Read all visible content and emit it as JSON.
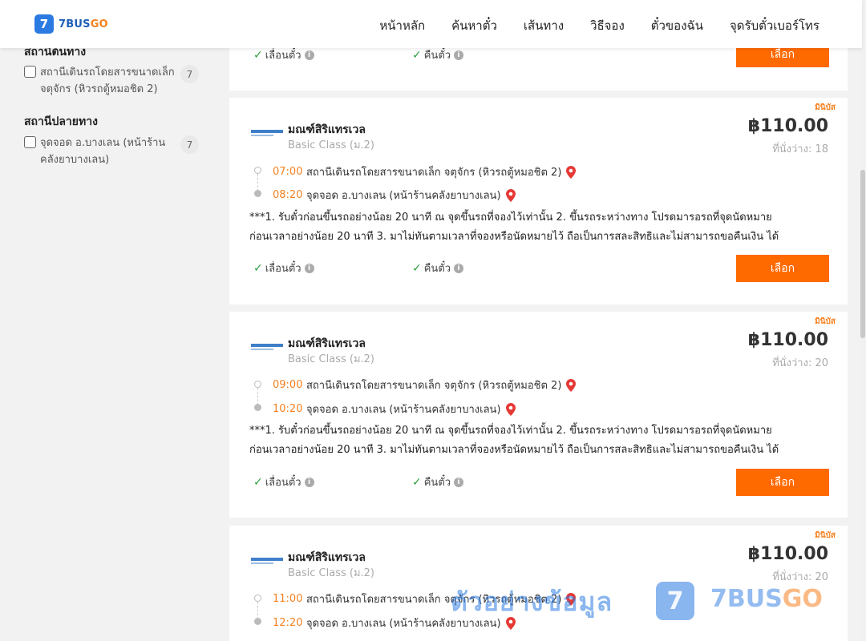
{
  "header": {
    "logo_mark": "7",
    "logo_brand": "7BUS",
    "logo_brand_accent": "GO",
    "nav": [
      "หน้าหลัก",
      "ค้นหาตั๋ว",
      "เส้นทาง",
      "วิธีจอง",
      "ตั๋วของฉัน",
      "จุดรับตั๋วเบอร์โทร"
    ]
  },
  "sidebar": {
    "origin_title": "สถานีต้นทาง",
    "origin_option": "สถานีเดินรถโดยสารขนาดเล็ก จตุจักร (หิวรถตู้หมอชิต 2)",
    "origin_count": "7",
    "dest_title": "สถานีปลายทาง",
    "dest_option": "จุดจอด อ.บางเลน (หน้าร้านคลังยาบางเลน)",
    "dest_count": "7"
  },
  "features": {
    "change": "เลื่อนตั๋ว",
    "refund": "คืนตั๋ว"
  },
  "select_label": "เลือก",
  "top_partial": {
    "change": "เลื่อนตั๋ว",
    "refund": "คืนตั๋ว",
    "button": "เลือก"
  },
  "trips": [
    {
      "type": "มินิบัส",
      "operator": "มณฑ์สิริแทรเวล",
      "class": "Basic Class (ม.2)",
      "price": "฿110.00",
      "seats": "ที่นั่งว่าง: 18",
      "depart_time": "07:00",
      "depart_stop": "สถานีเดินรถโดยสารขนาดเล็ก จตุจักร (หิวรถตู้หมอชิต 2)",
      "arrive_time": "08:20",
      "arrive_stop": "จุดจอด อ.บางเลน (หน้าร้านคลังยาบางเลน)",
      "note_line1": "***1. รับตั๋วก่อนขึ้นรถอย่างน้อย 20 นาที ณ จุดขึ้นรถที่จองไว้เท่านั้น 2. ขึ้นรถระหว่างทาง โปรดมารอรถที่จุดนัดหมาย",
      "note_line2": "ก่อนเวลาอย่างน้อย 20 นาที 3. มาไม่ทันตามเวลาที่จองหรือนัดหมายไว้ ถือเป็นการสละสิทธิและไม่สามารถขอคืนเงิน ได้"
    },
    {
      "type": "มินิบัส",
      "operator": "มณฑ์สิริแทรเวล",
      "class": "Basic Class (ม.2)",
      "price": "฿110.00",
      "seats": "ที่นั่งว่าง: 20",
      "depart_time": "09:00",
      "depart_stop": "สถานีเดินรถโดยสารขนาดเล็ก จตุจักร (หิวรถตู้หมอชิต 2)",
      "arrive_time": "10:20",
      "arrive_stop": "จุดจอด อ.บางเลน (หน้าร้านคลังยาบางเลน)",
      "note_line1": "***1. รับตั๋วก่อนขึ้นรถอย่างน้อย 20 นาที ณ จุดขึ้นรถที่จองไว้เท่านั้น 2. ขึ้นรถระหว่างทาง โปรดมารอรถที่จุดนัดหมาย",
      "note_line2": "ก่อนเวลาอย่างน้อย 20 นาที 3. มาไม่ทันตามเวลาที่จองหรือนัดหมายไว้ ถือเป็นการสละสิทธิและไม่สามารถขอคืนเงิน ได้"
    },
    {
      "type": "มินิบัส",
      "operator": "มณฑ์สิริแทรเวล",
      "class": "Basic Class (ม.2)",
      "price": "฿110.00",
      "seats": "ที่นั่งว่าง: 20",
      "depart_time": "11:00",
      "depart_stop": "สถานีเดินรถโดยสารขนาดเล็ก จตุจักร (หิวรถตู้หมอชิต 2)",
      "arrive_time": "12:20",
      "arrive_stop": "จุดจอด อ.บางเลน (หน้าร้านคลังยาบางเลน)"
    }
  ],
  "watermark": {
    "text": "ตัวอย่างข้อมูล",
    "logo_mark": "7",
    "brand": "7BUS",
    "brand_accent": "GO"
  },
  "colors": {
    "accent": "#ff6a00",
    "brand_blue": "#2a7ae2",
    "time_orange": "#f58220",
    "check_green": "#2e9e3e",
    "pin_red": "#e53935"
  },
  "icons": [
    "checkbox-icon",
    "check-icon",
    "info-icon",
    "location-pin-icon",
    "operator-logo"
  ]
}
